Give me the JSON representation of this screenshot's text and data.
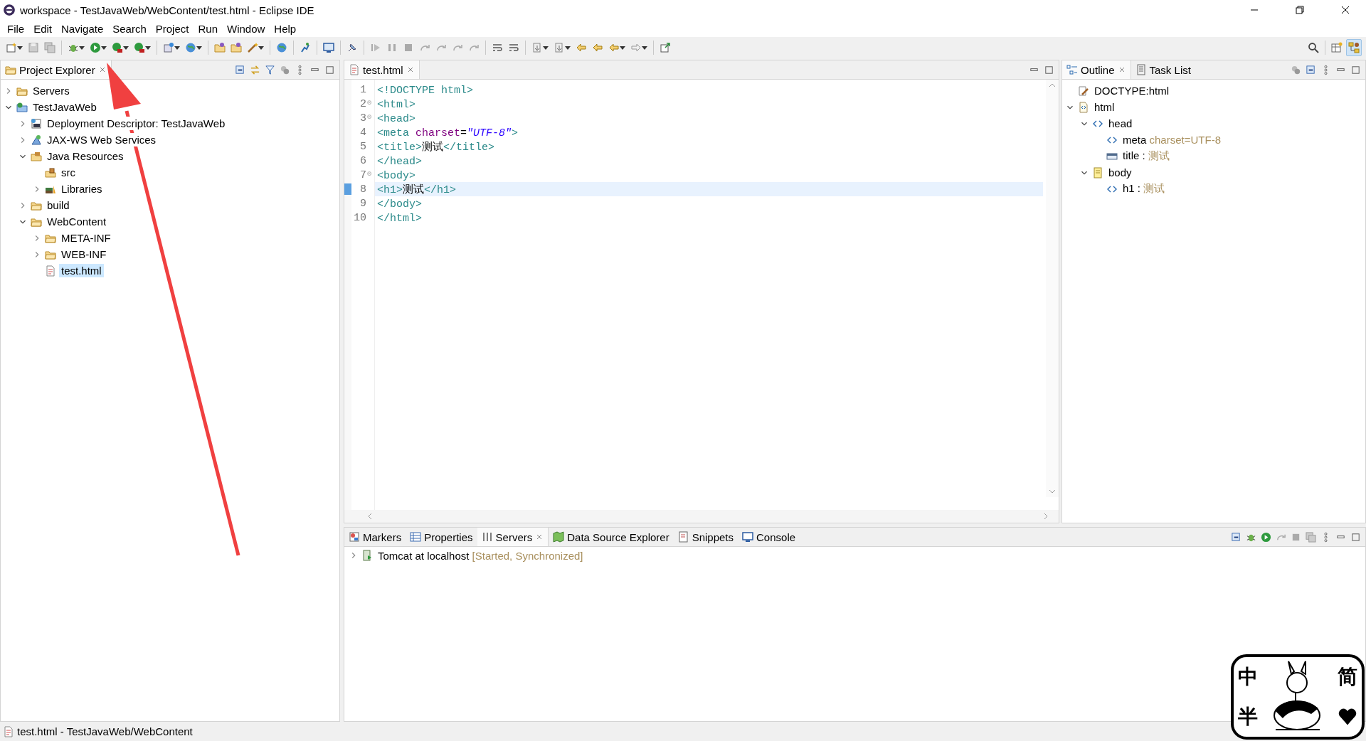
{
  "window": {
    "title": "workspace - TestJavaWeb/WebContent/test.html - Eclipse IDE"
  },
  "menu": [
    {
      "label": "File"
    },
    {
      "label": "Edit"
    },
    {
      "label": "Navigate"
    },
    {
      "label": "Search"
    },
    {
      "label": "Project"
    },
    {
      "label": "Run"
    },
    {
      "label": "Window"
    },
    {
      "label": "Help"
    }
  ],
  "project_explorer": {
    "tabs": [
      {
        "label": "Project Explorer",
        "selected": true
      }
    ],
    "tree": [
      {
        "label": "Servers",
        "kind": "folder",
        "expanded": false,
        "selected": false
      },
      {
        "label": "TestJavaWeb",
        "kind": "project",
        "expanded": true,
        "selected": false,
        "children": [
          {
            "label": "Deployment Descriptor: TestJavaWeb",
            "kind": "descriptor",
            "expanded": false,
            "selected": false
          },
          {
            "label": "JAX-WS Web Services",
            "kind": "webservice",
            "expanded": false,
            "selected": false
          },
          {
            "label": "Java Resources",
            "kind": "resources",
            "expanded": true,
            "selected": false,
            "children": [
              {
                "label": "src",
                "kind": "package",
                "selected": false
              },
              {
                "label": "Libraries",
                "kind": "library",
                "expanded": false,
                "selected": false
              }
            ]
          },
          {
            "label": "build",
            "kind": "folder",
            "expanded": false,
            "selected": false
          },
          {
            "label": "WebContent",
            "kind": "folder",
            "expanded": true,
            "selected": false,
            "children": [
              {
                "label": "META-INF",
                "kind": "folder",
                "expanded": false,
                "selected": false
              },
              {
                "label": "WEB-INF",
                "kind": "folder",
                "expanded": false,
                "selected": false
              },
              {
                "label": "test.html",
                "kind": "file",
                "selected": true
              }
            ]
          }
        ]
      }
    ]
  },
  "editor": {
    "tabs": [
      {
        "label": "test.html",
        "selected": true
      }
    ],
    "lines": [
      {
        "number": "1",
        "foldable": false,
        "current": false,
        "tokens": [
          {
            "kind": "tag",
            "text": "<!DOCTYPE html>"
          }
        ]
      },
      {
        "number": "2",
        "foldable": true,
        "current": false,
        "tokens": [
          {
            "kind": "tag",
            "text": "<html>"
          }
        ]
      },
      {
        "number": "3",
        "foldable": true,
        "current": false,
        "tokens": [
          {
            "kind": "tag",
            "text": "<head>"
          }
        ]
      },
      {
        "number": "4",
        "foldable": false,
        "current": false,
        "tokens": [
          {
            "kind": "tag",
            "text": "<meta "
          },
          {
            "kind": "attr",
            "text": "charset"
          },
          {
            "kind": "text",
            "text": "="
          },
          {
            "kind": "value",
            "text": "\"UTF-8\""
          },
          {
            "kind": "tag",
            "text": ">"
          }
        ]
      },
      {
        "number": "5",
        "foldable": false,
        "current": false,
        "tokens": [
          {
            "kind": "tag",
            "text": "<title>"
          },
          {
            "kind": "text",
            "text": "测试"
          },
          {
            "kind": "tag",
            "text": "</title>"
          }
        ]
      },
      {
        "number": "6",
        "foldable": false,
        "current": false,
        "tokens": [
          {
            "kind": "tag",
            "text": "</head>"
          }
        ]
      },
      {
        "number": "7",
        "foldable": true,
        "current": false,
        "tokens": [
          {
            "kind": "tag",
            "text": "<body>"
          }
        ]
      },
      {
        "number": "8",
        "foldable": false,
        "current": true,
        "tokens": [
          {
            "kind": "tag",
            "text": "<h1>"
          },
          {
            "kind": "text",
            "text": "测试"
          },
          {
            "kind": "tag",
            "text": "</h1>"
          }
        ]
      },
      {
        "number": "9",
        "foldable": false,
        "current": false,
        "tokens": [
          {
            "kind": "tag",
            "text": "</body>"
          }
        ]
      },
      {
        "number": "10",
        "foldable": false,
        "current": false,
        "tokens": [
          {
            "kind": "tag",
            "text": "</html>"
          }
        ]
      }
    ]
  },
  "outline": {
    "tabs": [
      {
        "label": "Outline",
        "kind": "outline",
        "selected": true
      },
      {
        "label": "Task List",
        "kind": "tasks",
        "selected": false
      }
    ],
    "tree": [
      {
        "label": "DOCTYPE:html",
        "kind": "doctype"
      },
      {
        "label": "html",
        "kind": "html",
        "expanded": true,
        "children": [
          {
            "label": "head",
            "kind": "tag",
            "expanded": true,
            "children": [
              {
                "label": "meta",
                "detail": "charset=UTF-8",
                "kind": "tag"
              },
              {
                "label": "title :",
                "detail": "测试",
                "kind": "title"
              }
            ]
          },
          {
            "label": "body",
            "kind": "body",
            "expanded": true,
            "children": [
              {
                "label": "h1 :",
                "detail": "测试",
                "kind": "tag"
              }
            ]
          }
        ]
      }
    ]
  },
  "bottom_panel": {
    "tabs": [
      {
        "label": "Markers",
        "kind": "markers",
        "selected": false
      },
      {
        "label": "Properties",
        "kind": "properties",
        "selected": false
      },
      {
        "label": "Servers",
        "kind": "servers",
        "selected": true
      },
      {
        "label": "Data Source Explorer",
        "kind": "datasource",
        "selected": false
      },
      {
        "label": "Snippets",
        "kind": "snippets",
        "selected": false
      },
      {
        "label": "Console",
        "kind": "console",
        "selected": false
      }
    ],
    "servers": [
      {
        "name": "Tomcat at localhost",
        "status": "[Started, Synchronized]",
        "expanded": false
      }
    ]
  },
  "status_bar": {
    "text": "test.html - TestJavaWeb/WebContent"
  },
  "ime_widget": {
    "labels": [
      "中",
      "半",
      "简"
    ]
  }
}
